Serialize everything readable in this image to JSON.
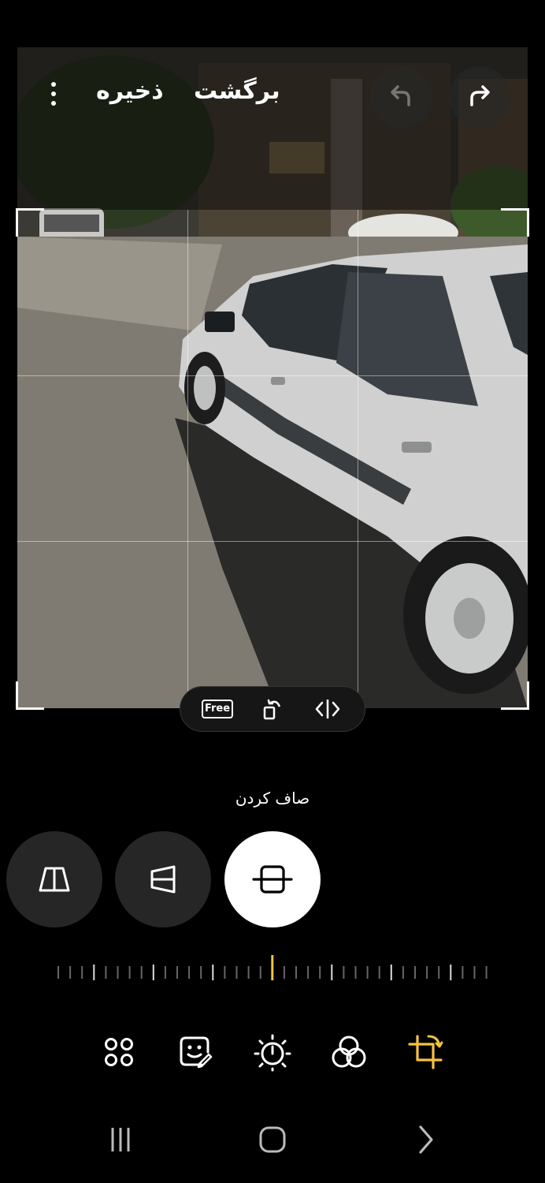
{
  "topbar": {
    "save_label": "ذخیره",
    "back_label": "برگشت"
  },
  "crop_pill": {
    "free_label": "Free"
  },
  "mode": {
    "label": "صاف کردن",
    "active_index": 2
  },
  "slider": {
    "value": 0
  },
  "tools": [
    "more-tools",
    "sticker-decorate",
    "brightness-adjust",
    "filters",
    "crop-transform"
  ],
  "colors": {
    "accent": "#f5c342",
    "background": "#000000",
    "button_dark": "#262626"
  }
}
